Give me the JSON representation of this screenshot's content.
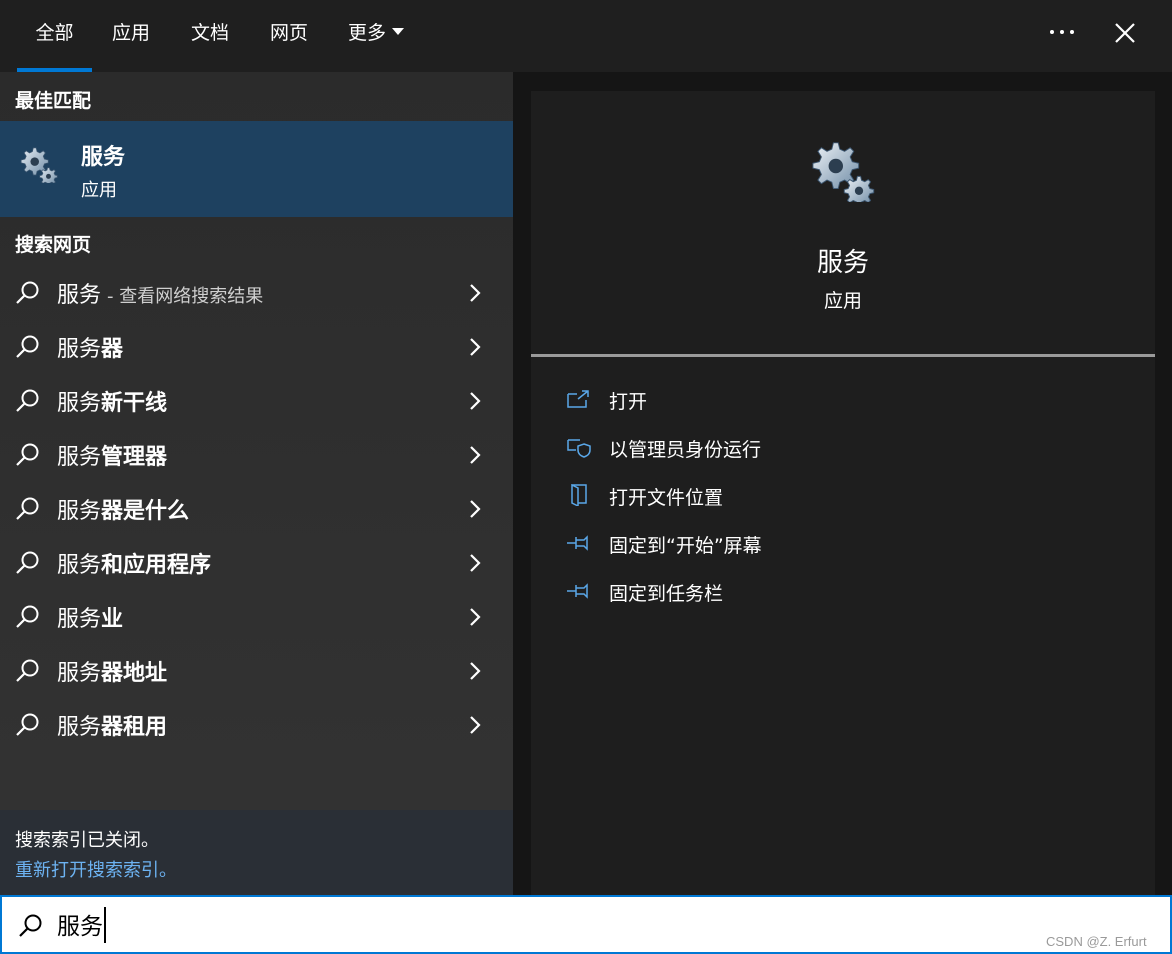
{
  "tabs": [
    {
      "label": "全部",
      "active": true
    },
    {
      "label": "应用"
    },
    {
      "label": "文档"
    },
    {
      "label": "网页"
    },
    {
      "label": "更多"
    }
  ],
  "best_match": {
    "heading": "最佳匹配",
    "title": "服务",
    "subtitle": "应用",
    "icon": "gears-icon"
  },
  "web_search": {
    "heading": "搜索网页",
    "results": [
      {
        "prefix": "服务",
        "bold": "",
        "suffix": "- 查看网络搜索结果"
      },
      {
        "prefix": "服务",
        "bold": "器",
        "suffix": ""
      },
      {
        "prefix": "服务",
        "bold": "新干线",
        "suffix": ""
      },
      {
        "prefix": "服务",
        "bold": "管理器",
        "suffix": ""
      },
      {
        "prefix": "服务",
        "bold": "器是什么",
        "suffix": ""
      },
      {
        "prefix": "服务",
        "bold": "和应用程序",
        "suffix": ""
      },
      {
        "prefix": "服务",
        "bold": "业",
        "suffix": ""
      },
      {
        "prefix": "服务",
        "bold": "器地址",
        "suffix": ""
      },
      {
        "prefix": "服务",
        "bold": "器租用",
        "suffix": ""
      }
    ]
  },
  "index_notice": {
    "text": "搜索索引已关闭。",
    "link": "重新打开搜索索引。"
  },
  "detail": {
    "title": "服务",
    "subtitle": "应用",
    "actions": [
      {
        "label": "打开",
        "icon": "open-icon"
      },
      {
        "label": "以管理员身份运行",
        "icon": "shield-icon"
      },
      {
        "label": "打开文件位置",
        "icon": "file-location-icon"
      },
      {
        "label": "固定到“开始”屏幕",
        "icon": "pin-icon"
      },
      {
        "label": "固定到任务栏",
        "icon": "pin-icon"
      }
    ]
  },
  "search": {
    "value": "服务"
  },
  "watermark": "CSDN @Z. Erfurt",
  "colors": {
    "accent": "#0078d4",
    "selected_bg": "#1e4160",
    "link": "#6db3f2"
  }
}
